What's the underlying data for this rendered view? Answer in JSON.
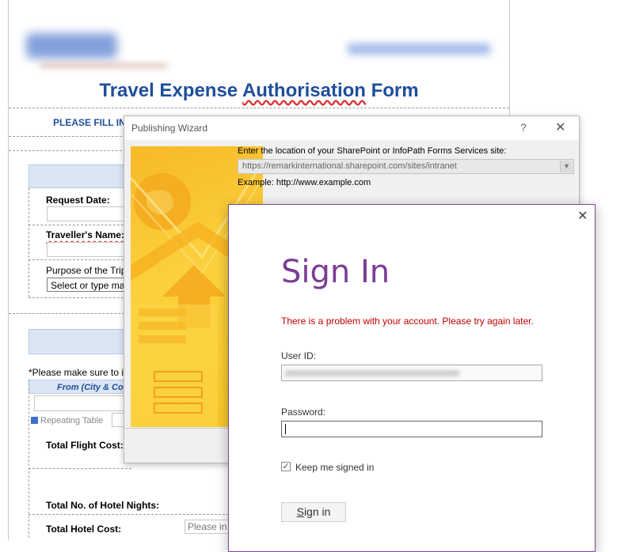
{
  "form": {
    "title_prefix": "Travel Expense ",
    "title_underlined": "Authorisation",
    "title_suffix": " Form",
    "fill_in": "PLEASE FILL IN",
    "request_date_label": "Request Date:",
    "travellers_name_label": "Traveller's Name:",
    "purpose_label": "Purpose of the Trip",
    "purpose_select": "Select or type ma",
    "note": "*Please make sure to i",
    "table_header": "From (City & Co",
    "repeating_table": "Repeating Table",
    "total_flight_cost": "Total Flight Cost:",
    "total_hotel_nights": "Total No. of Hotel Nights:",
    "total_hotel_cost": "Total Hotel Cost:",
    "hotel_cost_placeholder": "Please in"
  },
  "wizard": {
    "title": "Publishing Wizard",
    "help_icon": "?",
    "close_icon": "✕",
    "prompt": "Enter the location of your SharePoint or InfoPath Forms Services site:",
    "url": "https://remarkinternational.sharepoint.com/sites/intranet",
    "example": "Example: http://www.example.com"
  },
  "signin": {
    "close_icon": "✕",
    "title": "Sign In",
    "error": "There is a problem with your account. Please try again later.",
    "user_id_label": "User ID:",
    "password_label": "Password:",
    "keep_signed_in": "Keep me signed in",
    "keep_signed_in_checked": true,
    "button_label_underlined": "S",
    "button_label_rest": "ign in"
  },
  "colors": {
    "form_title": "#1f4e9a",
    "signin_title": "#7b3c94",
    "error": "#c00000",
    "art_gold": "#f7b928"
  }
}
